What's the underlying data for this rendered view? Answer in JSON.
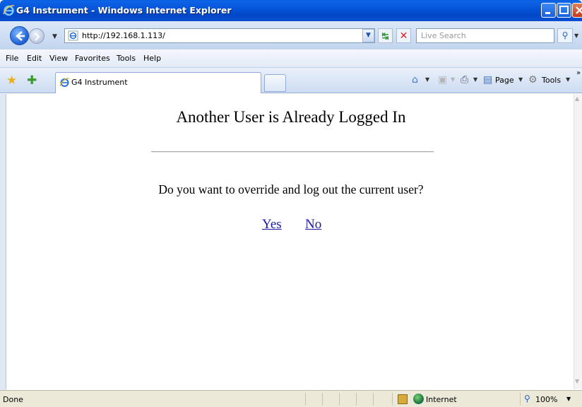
{
  "window": {
    "title": "G4 Instrument - Windows Internet Explorer"
  },
  "address_bar": {
    "url": "http://192.168.1.113/",
    "search_placeholder": "Live Search"
  },
  "menu": {
    "items": [
      "File",
      "Edit",
      "View",
      "Favorites",
      "Tools",
      "Help"
    ]
  },
  "tabs": [
    {
      "label": "G4 Instrument",
      "active": true
    }
  ],
  "command_bar": {
    "page_label": "Page",
    "tools_label": "Tools"
  },
  "page": {
    "heading": "Another User is Already Logged In",
    "question": "Do you want to override and log out the current user?",
    "yes_link": "Yes",
    "no_link": "No"
  },
  "status_bar": {
    "status": "Done",
    "zone": "Internet",
    "zoom": "100%"
  },
  "colors": {
    "titlebar": "#0553d6",
    "link": "#1a1aa8"
  }
}
